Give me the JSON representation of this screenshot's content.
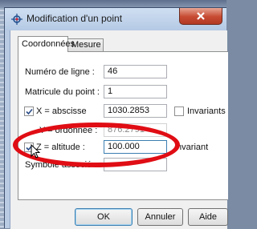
{
  "window": {
    "title": "Modification d'un point",
    "close_icon": "close-icon",
    "title_icon": "point-crosshair-icon"
  },
  "tabs": [
    {
      "label": "Coordonnées",
      "active": true
    },
    {
      "label": "Mesure",
      "active": false
    }
  ],
  "form": {
    "line_number": {
      "label": "Numéro de ligne :",
      "value": "46"
    },
    "point_matricule": {
      "label": "Matricule du point :",
      "value": "1"
    },
    "x": {
      "label": "X = abscisse",
      "checked": true,
      "value": "1030.2853",
      "invariant_label": "Invariants",
      "invariant_checked": false
    },
    "y": {
      "label": "Y = ordonnée :",
      "value": "876.2791"
    },
    "z": {
      "label": "Z = altitude :",
      "checked": true,
      "value": "100.000",
      "invariant_label": "Invariant"
    },
    "symbol": {
      "label": "Symbole associé :",
      "value": ""
    }
  },
  "buttons": {
    "ok": "OK",
    "cancel": "Annuler",
    "help": "Aide"
  },
  "colors": {
    "annotation": "#e00d14",
    "close_button": "#c74a32",
    "titlebar": "#b9cbe3"
  }
}
